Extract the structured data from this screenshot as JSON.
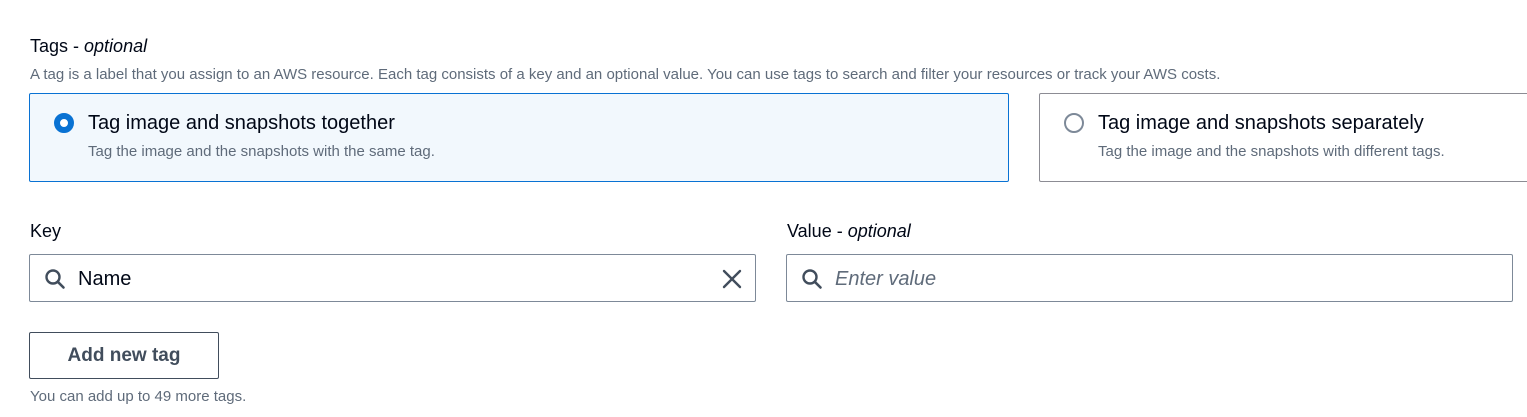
{
  "section": {
    "title": "Tags",
    "title_sep": " - ",
    "title_optional": "optional",
    "description": "A tag is a label that you assign to an AWS resource. Each tag consists of a key and an optional value. You can use tags to search and filter your resources or track your AWS costs."
  },
  "tiles": [
    {
      "label": "Tag image and snapshots together",
      "description": "Tag the image and the snapshots with the same tag.",
      "selected": true
    },
    {
      "label": "Tag image and snapshots separately",
      "description": "Tag the image and the snapshots with different tags.",
      "selected": false
    }
  ],
  "key_field": {
    "label": "Key",
    "value": "Name",
    "icon": "search-icon",
    "clear_icon": "close-icon"
  },
  "value_field": {
    "label": "Value",
    "label_sep": " - ",
    "label_optional": "optional",
    "placeholder": "Enter value",
    "icon": "search-icon"
  },
  "add_button": {
    "label": "Add new tag"
  },
  "hint": "You can add up to 49 more tags.",
  "colors": {
    "accent": "#0972d3",
    "selected_bg": "#f2f8fd",
    "text": "#000716",
    "muted": "#5f6b7a",
    "button": "#414d5c"
  }
}
